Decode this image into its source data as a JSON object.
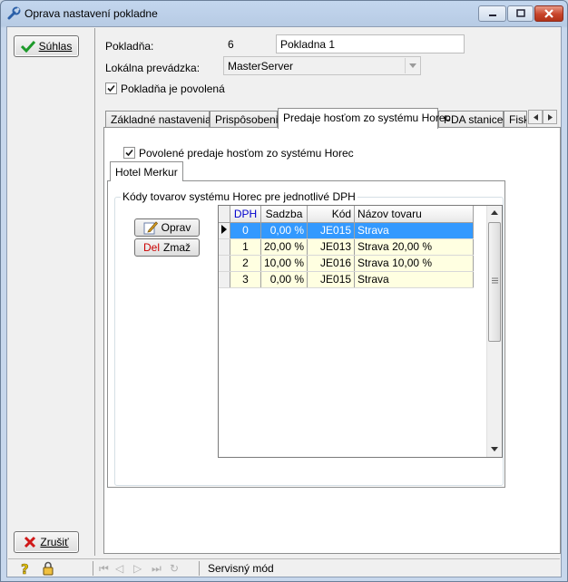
{
  "window": {
    "title": "Oprava nastavení pokladne"
  },
  "left": {
    "confirm_label": "Súhlas",
    "cancel_label": "Zrušiť"
  },
  "form": {
    "pokladna_label": "Pokladňa:",
    "pokladna_id": "6",
    "pokladna_name": "Pokladna 1",
    "prevadzka_label": "Lokálna prevádzka:",
    "prevadzka_value": "MasterServer",
    "enabled_label": "Pokladňa je povolená",
    "enabled_checked": true
  },
  "tabs": [
    {
      "label": "Základné nastavenia",
      "active": false
    },
    {
      "label": "Prispôsobenia",
      "active": false
    },
    {
      "label": "Predaje hosťom zo systému Horec",
      "active": true
    },
    {
      "label": "PDA stanice",
      "active": false
    },
    {
      "label": "Fisk",
      "active": false
    }
  ],
  "horec": {
    "allowed_label": "Povolené predaje hosťom zo systému Horec",
    "allowed_checked": true,
    "hotel_tab": "Hotel Merkur",
    "group_title": "Kódy tovarov systému Horec pre jednotlivé DPH",
    "edit_button": "Oprav",
    "delete_prefix": "Del",
    "delete_button": "Zmaž"
  },
  "grid": {
    "columns": [
      "DPH",
      "Sadzba",
      "Kód",
      "Názov tovaru"
    ],
    "rows": [
      {
        "dph": "0",
        "sadzba": "0,00 %",
        "kod": "JE015",
        "nazov": "Strava"
      },
      {
        "dph": "1",
        "sadzba": "20,00 %",
        "kod": "JE013",
        "nazov": "Strava 20,00 %"
      },
      {
        "dph": "2",
        "sadzba": "10,00 %",
        "kod": "JE016",
        "nazov": "Strava 10,00 %"
      },
      {
        "dph": "3",
        "sadzba": "0,00 %",
        "kod": "JE015",
        "nazov": "Strava"
      }
    ],
    "selected_row": 0
  },
  "status": {
    "mode_text": "Servisný mód"
  },
  "colors": {
    "selection": "#3399ff",
    "row_highlight": "#ffffe1",
    "header_blue": "#0000cc",
    "delete_red": "#cc0000"
  }
}
